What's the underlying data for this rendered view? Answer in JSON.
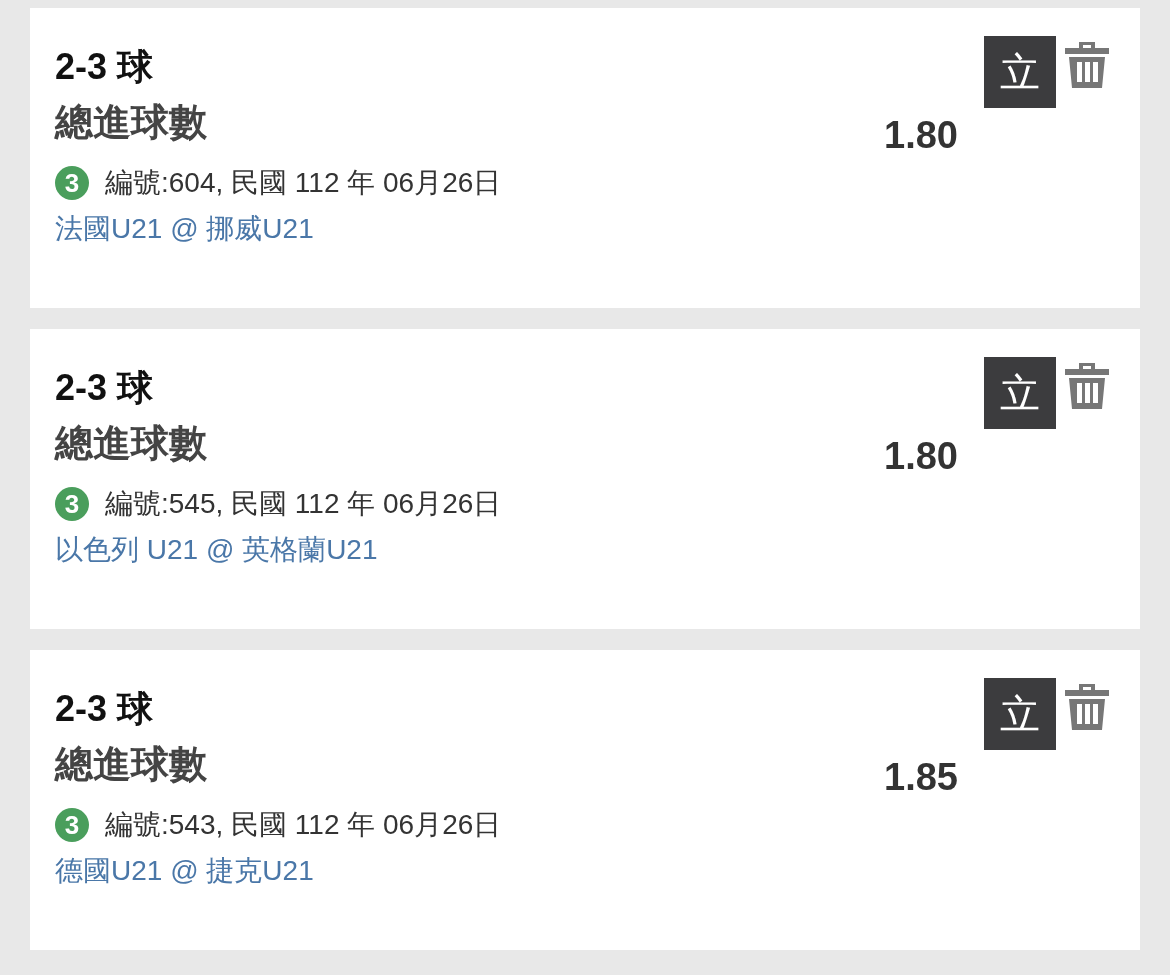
{
  "bets": [
    {
      "selection": "2-3 球",
      "market": "總進球數",
      "odds": "1.80",
      "badge": "3",
      "info": "編號:604, 民國 112 年 06月26日",
      "match": "法國U21 @ 挪威U21",
      "action": "立"
    },
    {
      "selection": "2-3 球",
      "market": "總進球數",
      "odds": "1.80",
      "badge": "3",
      "info": "編號:545, 民國 112 年 06月26日",
      "match": "以色列 U21 @ 英格蘭U21",
      "action": "立"
    },
    {
      "selection": "2-3 球",
      "market": "總進球數",
      "odds": "1.85",
      "badge": "3",
      "info": "編號:543, 民國 112 年 06月26日",
      "match": "德國U21 @ 捷克U21",
      "action": "立"
    }
  ]
}
